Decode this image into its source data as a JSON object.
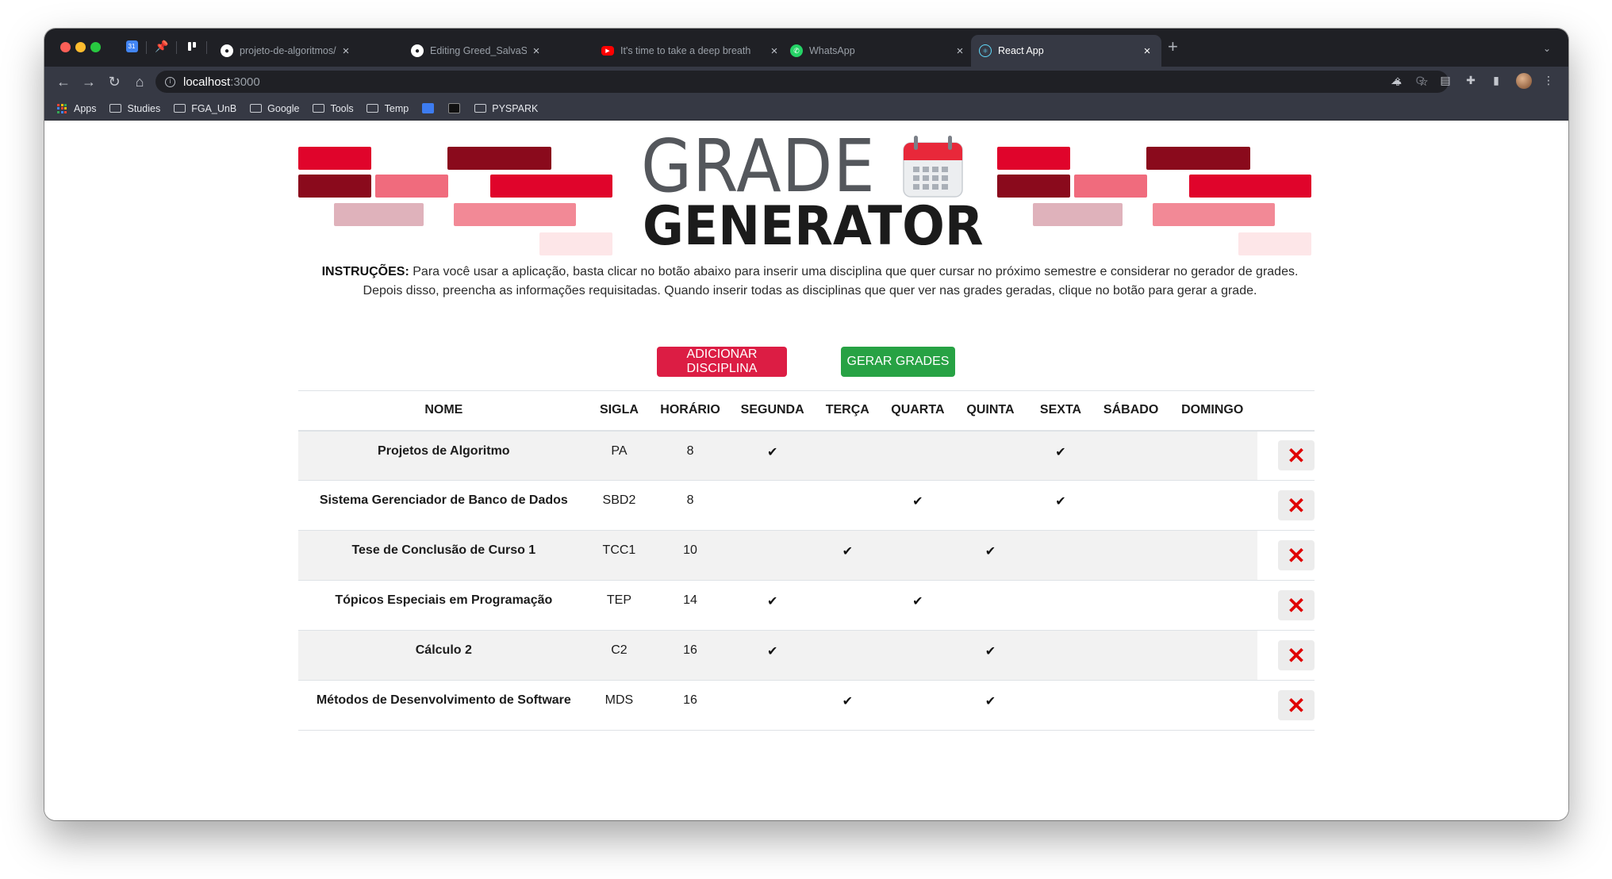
{
  "browser": {
    "tabs": [
      {
        "title": "projeto-de-algoritmos/PD_Gra",
        "icon": "github-icon"
      },
      {
        "title": "Editing Greed_SalvaSemestre/",
        "icon": "github-icon"
      },
      {
        "title": "It's time to take a deep breath",
        "icon": "youtube-icon"
      },
      {
        "title": "WhatsApp",
        "icon": "whatsapp-icon"
      },
      {
        "title": "React App",
        "icon": "react-icon",
        "active": true
      }
    ],
    "address": {
      "host": "localhost",
      "port": ":3000"
    },
    "bookmarks": [
      {
        "label": "Apps",
        "icon": "apps-grid-icon"
      },
      {
        "label": "Studies",
        "icon": "folder-icon"
      },
      {
        "label": "FGA_UnB",
        "icon": "folder-icon"
      },
      {
        "label": "Google",
        "icon": "folder-icon"
      },
      {
        "label": "Tools",
        "icon": "folder-icon"
      },
      {
        "label": "Temp",
        "icon": "folder-icon"
      },
      {
        "label": "PYSPARK",
        "icon": "folder-icon"
      }
    ]
  },
  "logo": {
    "line1": "GRADE",
    "line2": "GENERATOR"
  },
  "instructions": {
    "bold": "INSTRUÇÕES:",
    "line1": "Para você usar a aplicação, basta clicar no botão abaixo para inserir uma disciplina que quer cursar no próximo semestre e considerar no gerador de grades.",
    "line2": "Depois disso, preencha as informações requisitadas. Quando inserir todas as disciplinas que quer ver nas grades geradas, clique no botão para gerar a grade."
  },
  "buttons": {
    "add": "ADICIONAR DISCIPLINA",
    "generate": "GERAR GRADES"
  },
  "colors": {
    "add_button": "#dc1d44",
    "generate_button": "#27a244",
    "delete_icon": "#e00000"
  },
  "table": {
    "headers": [
      "NOME",
      "SIGLA",
      "HORÁRIO",
      "SEGUNDA",
      "TERÇA",
      "QUARTA",
      "QUINTA",
      "SEXTA",
      "SÁBADO",
      "DOMINGO"
    ],
    "check_mark": "✔",
    "delete_glyph": "✕",
    "rows": [
      {
        "nome": "Projetos de Algoritmo",
        "sigla": "PA",
        "horario": "8",
        "days": [
          true,
          false,
          false,
          false,
          true,
          false,
          false
        ]
      },
      {
        "nome": "Sistema Gerenciador de Banco de Dados",
        "sigla": "SBD2",
        "horario": "8",
        "days": [
          false,
          false,
          true,
          false,
          true,
          false,
          false
        ]
      },
      {
        "nome": "Tese de Conclusão de Curso 1",
        "sigla": "TCC1",
        "horario": "10",
        "days": [
          false,
          true,
          false,
          true,
          false,
          false,
          false
        ]
      },
      {
        "nome": "Tópicos Especiais em Programação",
        "sigla": "TEP",
        "horario": "14",
        "days": [
          true,
          false,
          true,
          false,
          false,
          false,
          false
        ]
      },
      {
        "nome": "Cálculo 2",
        "sigla": "C2",
        "horario": "16",
        "days": [
          true,
          false,
          false,
          true,
          false,
          false,
          false
        ]
      },
      {
        "nome": "Métodos de Desenvolvimento de Software",
        "sigla": "MDS",
        "horario": "16",
        "days": [
          false,
          true,
          false,
          true,
          false,
          false,
          false
        ]
      }
    ]
  }
}
